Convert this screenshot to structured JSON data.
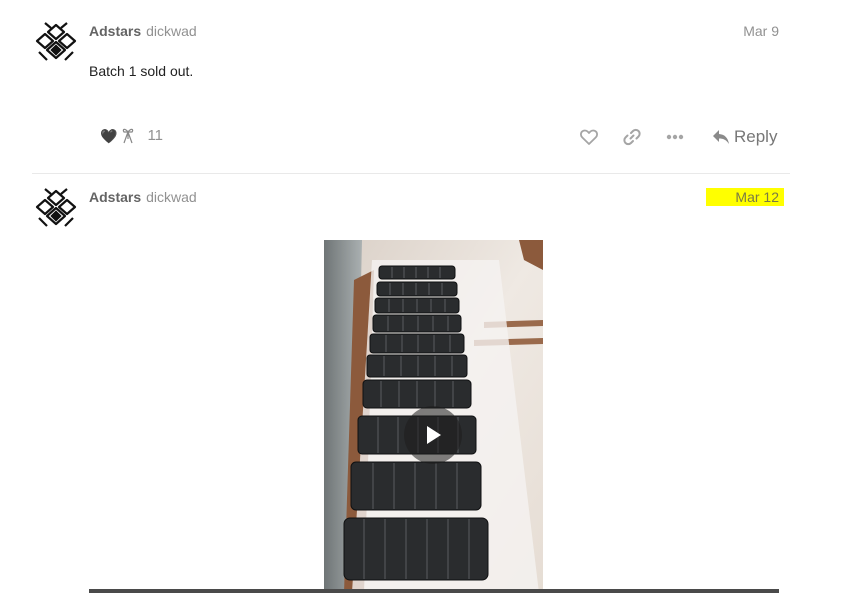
{
  "posts": [
    {
      "username": "Adstars",
      "fullname": "dickwad",
      "date": "Mar 9",
      "body": "Batch 1 sold out.",
      "reactions": {
        "icons": [
          "black-heart-icon",
          "gift-ribbon-icon"
        ],
        "count": "11"
      },
      "actions": {
        "reply_label": "Reply"
      }
    },
    {
      "username": "Adstars",
      "fullname": "dickwad",
      "date": "Mar 12",
      "highlight_color": "#ffff00",
      "media": {
        "type": "video",
        "icon": "play-icon"
      }
    }
  ]
}
